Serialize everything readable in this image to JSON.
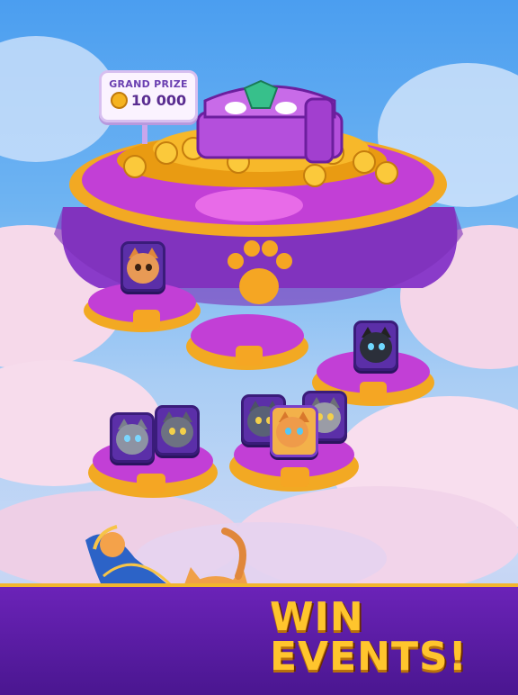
{
  "grand_prize": {
    "label": "GRAND PRIZE",
    "value": "10 000",
    "coin_icon": "coin-icon"
  },
  "banner": {
    "line1": "WIN",
    "line2": "EVENTS!"
  },
  "colors": {
    "sky": "#4b9ef0",
    "platform": "#c23fd6",
    "gold": "#ffc52d",
    "banner": "#6b23b8"
  },
  "characters": [
    {
      "name": "witch-cat-orange",
      "icon": "cat-portrait-icon"
    },
    {
      "name": "shadow-cat-hood",
      "icon": "cat-portrait-icon"
    },
    {
      "name": "fluffy-gray-cat",
      "icon": "cat-portrait-icon"
    },
    {
      "name": "wizard-cat-gray",
      "icon": "cat-portrait-icon"
    },
    {
      "name": "hooded-gray-cat",
      "icon": "cat-portrait-icon"
    },
    {
      "name": "ginger-cat-player",
      "icon": "cat-portrait-icon"
    },
    {
      "name": "gray-wizard-cat",
      "icon": "cat-portrait-icon"
    }
  ]
}
